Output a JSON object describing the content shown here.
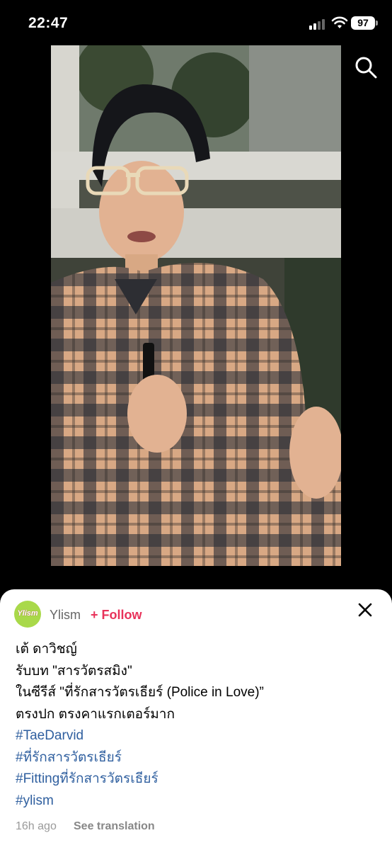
{
  "status_bar": {
    "time": "22:47",
    "battery": "97"
  },
  "post": {
    "author": "Ylism",
    "avatar_text": "Ylism",
    "follow_label": "+ Follow",
    "caption_lines": [
      "เต้ ดาวิชญ์",
      "รับบท \"สารวัตรสมิง\"",
      "ในซีรีส์ \"ที่รักสารวัตรเธียร์ (Police in Love)”",
      "ตรงปก ตรงคาแรกเตอร์มาก"
    ],
    "hashtags": [
      "#TaeDarvid",
      "#ที่รักสารวัตรเธียร์",
      "#Fittingที่รักสารวัตรเธียร์",
      "#ylism"
    ],
    "time_ago": "16h ago",
    "translate_label": "See translation"
  },
  "colors": {
    "follow": "#e8325a",
    "hashtag": "#2f5f9f",
    "sheet": "#ffffff",
    "background": "#000000"
  },
  "icons": {
    "search": "search-icon",
    "close": "close-icon"
  }
}
